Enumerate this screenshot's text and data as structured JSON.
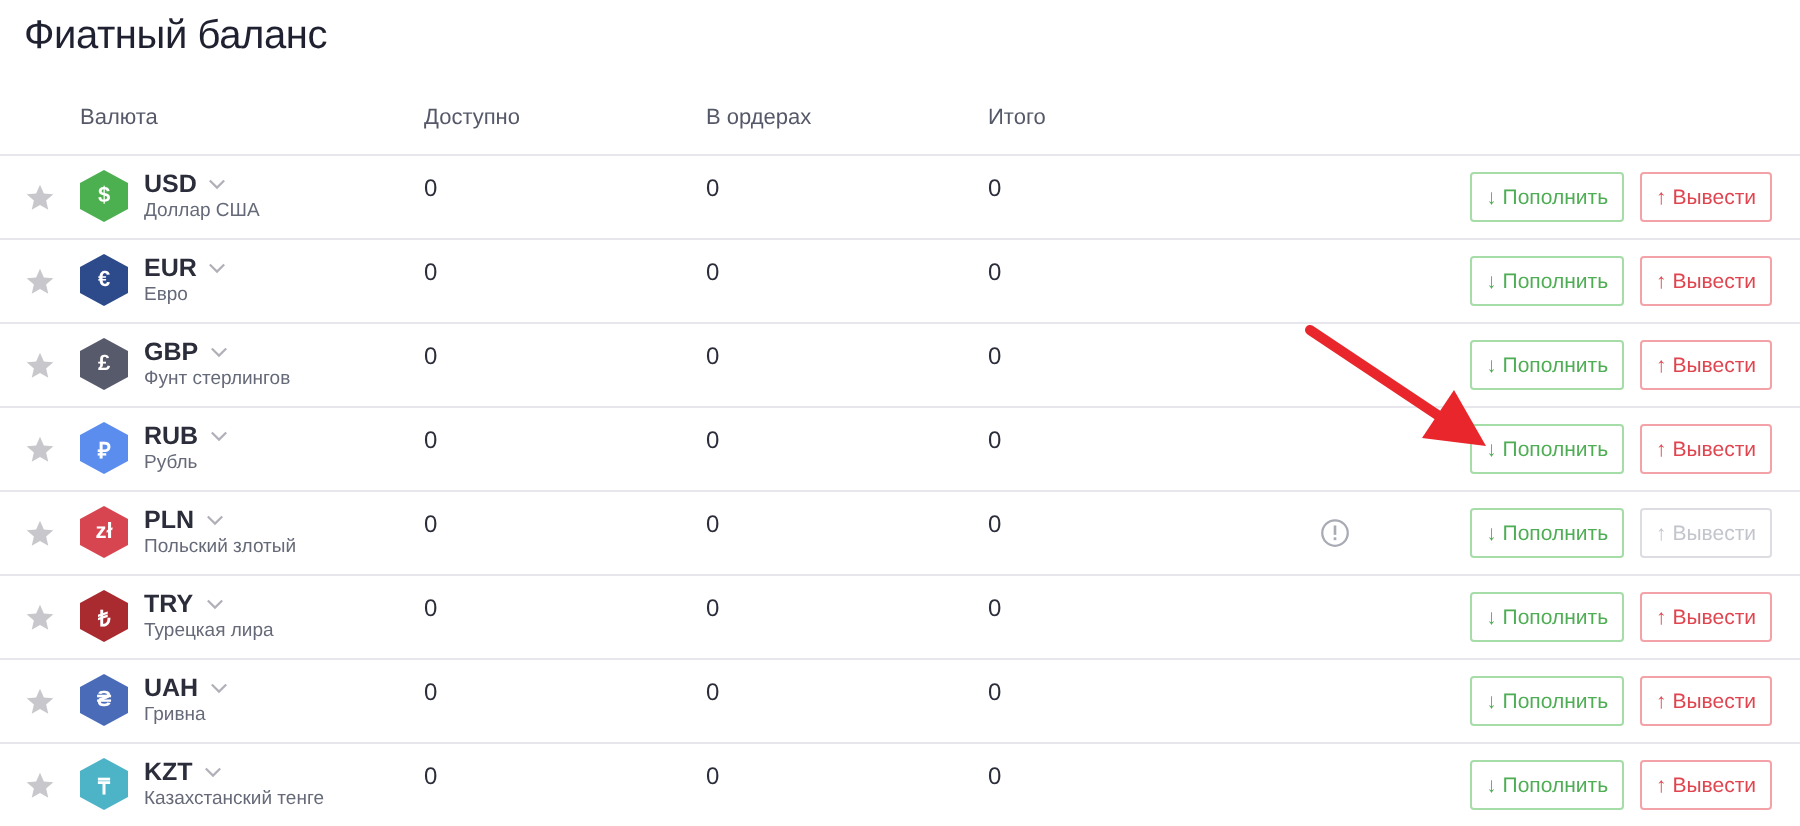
{
  "title": "Фиатный баланс",
  "columns": [
    "Валюта",
    "Доступно",
    "В ордерах",
    "Итого"
  ],
  "rows": [
    {
      "code": "USD",
      "name": "Доллар США",
      "symbol": "$",
      "color": "#4caf50",
      "available": "0",
      "in_orders": "0",
      "total": "0",
      "warning": false,
      "deposit_label": "↓ Пополнить",
      "withdraw_label": "↑ Вывести",
      "withdraw_disabled": false,
      "arrow_pointer": false
    },
    {
      "code": "EUR",
      "name": "Евро",
      "symbol": "€",
      "color": "#2d4a8a",
      "available": "0",
      "in_orders": "0",
      "total": "0",
      "warning": false,
      "deposit_label": "↓ Пополнить",
      "withdraw_label": "↑ Вывести",
      "withdraw_disabled": false,
      "arrow_pointer": false
    },
    {
      "code": "GBP",
      "name": "Фунт стерлингов",
      "symbol": "£",
      "color": "#575a6b",
      "available": "0",
      "in_orders": "0",
      "total": "0",
      "warning": false,
      "deposit_label": "↓ Пополнить",
      "withdraw_label": "↑ Вывести",
      "withdraw_disabled": false,
      "arrow_pointer": false
    },
    {
      "code": "RUB",
      "name": "Рубль",
      "symbol": "₽",
      "color": "#5b8def",
      "available": "0",
      "in_orders": "0",
      "total": "0",
      "warning": false,
      "deposit_label": "↓ Пополнить",
      "withdraw_label": "↑ Вывести",
      "withdraw_disabled": false,
      "arrow_pointer": true
    },
    {
      "code": "PLN",
      "name": "Польский злотый",
      "symbol": "zł",
      "color": "#d64550",
      "available": "0",
      "in_orders": "0",
      "total": "0",
      "warning": true,
      "deposit_label": "↓ Пополнить",
      "withdraw_label": "↑ Вывести",
      "withdraw_disabled": true,
      "arrow_pointer": false
    },
    {
      "code": "TRY",
      "name": "Турецкая лира",
      "symbol": "₺",
      "color": "#a92b2f",
      "available": "0",
      "in_orders": "0",
      "total": "0",
      "warning": false,
      "deposit_label": "↓ Пополнить",
      "withdraw_label": "↑ Вывести",
      "withdraw_disabled": false,
      "arrow_pointer": false
    },
    {
      "code": "UAH",
      "name": "Гривна",
      "symbol": "₴",
      "color": "#4a6cb8",
      "available": "0",
      "in_orders": "0",
      "total": "0",
      "warning": false,
      "deposit_label": "↓ Пополнить",
      "withdraw_label": "↑ Вывести",
      "withdraw_disabled": false,
      "arrow_pointer": false
    },
    {
      "code": "KZT",
      "name": "Казахстанский тенге",
      "symbol": "₸",
      "color": "#4db3c6",
      "available": "0",
      "in_orders": "0",
      "total": "0",
      "warning": false,
      "deposit_label": "↓ Пополнить",
      "withdraw_label": "↑ Вывести",
      "withdraw_disabled": false,
      "arrow_pointer": false
    }
  ]
}
